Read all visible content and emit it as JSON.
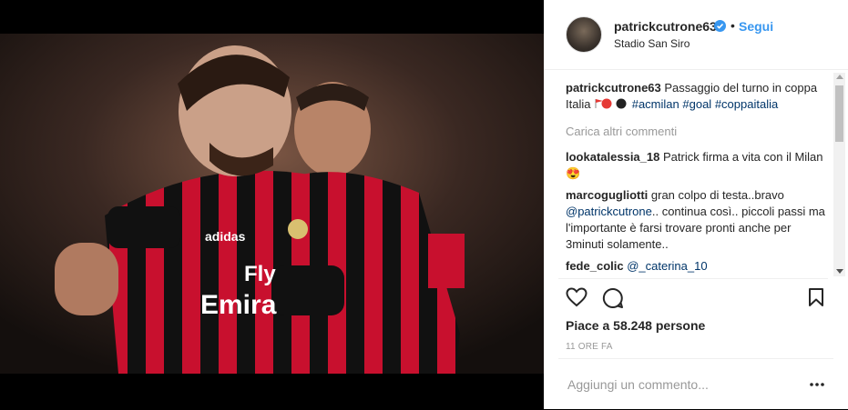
{
  "post": {
    "username": "patrickcutrone63",
    "follow_label": "Segui",
    "dot": "•",
    "location": "Stadio San Siro",
    "photo_text": {
      "jersey_line1": "Fly",
      "jersey_line2": "Emira",
      "brand": "adidas"
    },
    "caption": {
      "username": "patrickcutrone63",
      "text": " Passaggio del turno in coppa Italia",
      "hashtags": [
        "#acmilan",
        "#goal",
        "#coppaitalia"
      ]
    },
    "load_more": "Carica altri commenti",
    "comments": [
      {
        "user": "lookatalessia_18",
        "text": " Patrick firma a vita con il Milan",
        "emoji": "😍"
      },
      {
        "user": "marcogugliotti",
        "text_before": " gran colpo di testa..bravo ",
        "mention": "@patrickcutrone",
        "text_after": ".. continua così.. piccoli passi ma l'importante è farsi trovare pronti anche per 3minuti solamente.."
      },
      {
        "user": "fede_colic",
        "mention": "@_caterina_10"
      }
    ],
    "likes": "Piace a 58.248 persone",
    "time": "11 ORE FA",
    "add_comment_placeholder": "Aggiungi un commento..."
  },
  "colors": {
    "accent": "#3897f0",
    "link": "#003569",
    "text": "#262626",
    "muted": "#999999",
    "milan_red": "#c8102e"
  }
}
